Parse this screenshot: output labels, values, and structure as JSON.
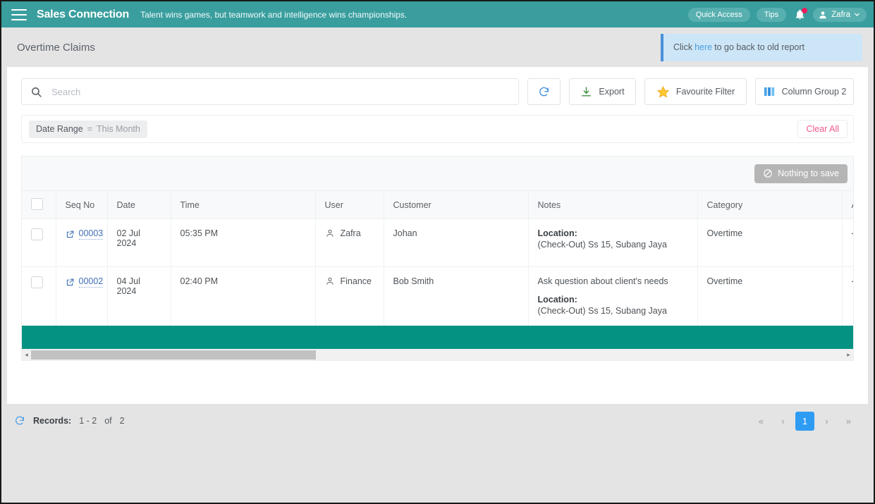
{
  "topbar": {
    "menu_icon": "hamburger-icon",
    "brand": "Sales Connection",
    "tagline": "Talent wins games, but teamwork and intelligence wins championships.",
    "quick_access": "Quick Access",
    "tips": "Tips",
    "notification_icon": "bell-icon",
    "user_name": "Zafra",
    "user_caret": "⌄",
    "brand_color": "#3a9e9e",
    "badge_color": "#ec1c5c"
  },
  "page": {
    "title": "Overtime Claims",
    "notice_prefix": "Click",
    "notice_link": "here",
    "notice_suffix": "to go back to old report",
    "notice_bg": "#cde6f7",
    "notice_accent": "#4a90d9"
  },
  "toolbar": {
    "search_placeholder": "Search",
    "search_value": "",
    "search_icon": "search-icon",
    "refresh_icon": "refresh-icon",
    "export_label": "Export",
    "export_icon": "download-icon",
    "favourite_label": "Favourite Filter",
    "favourite_icon": "star-icon",
    "column_group_label": "Column Group 2",
    "column_group_icon": "columns-icon"
  },
  "filters": {
    "chip_label": "Date Range",
    "chip_operator": "=",
    "chip_value": "This Month",
    "clear_all": "Clear All",
    "clear_all_color": "#f2598a"
  },
  "grid": {
    "save_state_label": "Nothing to save",
    "save_state_icon": "no-entry-icon",
    "select_all_checkbox": "",
    "columns": [
      "",
      "Seq No",
      "Date",
      "Time",
      "User",
      "Customer",
      "Notes",
      "Category",
      "A"
    ],
    "rows": [
      {
        "checkbox": "",
        "link_icon": "external-link-icon",
        "seq_no": "00003",
        "date": "02 Jul 2024",
        "time": "05:35 PM",
        "user_icon": "user-icon",
        "user": "Zafra",
        "customer": "Johan",
        "note_text": "",
        "note_label": "Location:",
        "note_value": "(Check-Out) Ss 15, Subang Jaya",
        "category": "Overtime",
        "amount": "-"
      },
      {
        "checkbox": "",
        "link_icon": "external-link-icon",
        "seq_no": "00002",
        "date": "04 Jul 2024",
        "time": "02:40 PM",
        "user_icon": "user-icon",
        "user": "Finance",
        "customer": "Bob Smith",
        "note_text": "Ask question about client's needs",
        "note_label": "Location:",
        "note_value": "(Check-Out) Ss 15, Subang Jaya",
        "category": "Overtime",
        "amount": "-"
      }
    ],
    "summary_bar_color": "#049382",
    "scroll_left_arrow": "◂",
    "scroll_right_arrow": "▸"
  },
  "footer": {
    "refresh_icon": "refresh-icon",
    "records_label": "Records:",
    "records_range": "1 - 2",
    "records_of": "of",
    "records_total": "2",
    "pager": {
      "first": "«",
      "prev": "‹",
      "pages": [
        "1"
      ],
      "next": "›",
      "last": "»",
      "active_page": "1",
      "active_color": "#2f9cf4"
    }
  }
}
